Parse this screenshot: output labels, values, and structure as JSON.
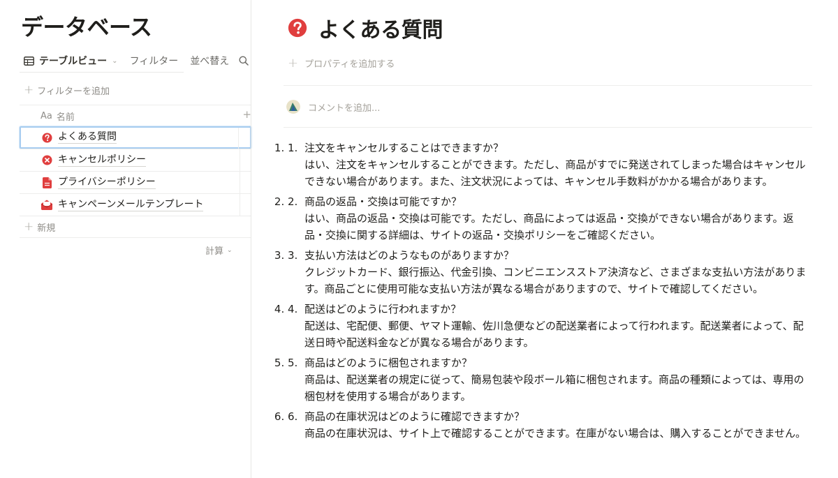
{
  "sidebar": {
    "title": "データベース",
    "view_label": "テーブルビュー",
    "filter_label": "フィルター",
    "sort_label": "並べ替え",
    "add_filter_label": "フィルターを追加",
    "column_type_label": "Aa",
    "column_name_label": "名前",
    "add_column_symbol": "+",
    "rows": [
      {
        "title": "よくある質問",
        "icon": "question-circle-icon",
        "selected": true
      },
      {
        "title": "キャンセルポリシー",
        "icon": "x-circle-icon",
        "selected": false
      },
      {
        "title": "プライバシーポリシー",
        "icon": "document-icon",
        "selected": false
      },
      {
        "title": "キャンペーンメールテンプレート",
        "icon": "mail-open-icon",
        "selected": false
      }
    ],
    "new_label": "新規",
    "calc_label": "計算"
  },
  "page": {
    "title": "よくある質問",
    "icon": "question-circle-icon",
    "add_property_label": "プロパティを追加する",
    "comment_placeholder": "コメントを追加...",
    "faq": [
      {
        "num": "1.",
        "question": "注文をキャンセルすることはできますか？",
        "answer": "はい、注文をキャンセルすることができます。ただし、商品がすでに発送されてしまった場合はキャンセルできない場合があります。また、注文状況によっては、キャンセル手数料がかかる場合があります。"
      },
      {
        "num": "2.",
        "question": "商品の返品・交換は可能ですか？",
        "answer": "はい、商品の返品・交換は可能です。ただし、商品によっては返品・交換ができない場合があります。返品・交換に関する詳細は、サイトの返品・交換ポリシーをご確認ください。"
      },
      {
        "num": "3.",
        "question": "支払い方法はどのようなものがありますか？",
        "answer": "クレジットカード、銀行振込、代金引換、コンビニエンスストア決済など、さまざまな支払い方法があります。商品ごとに使用可能な支払い方法が異なる場合がありますので、サイトで確認してください。"
      },
      {
        "num": "4.",
        "question": "配送はどのように行われますか？",
        "answer": "配送は、宅配便、郵便、ヤマト運輸、佐川急便などの配送業者によって行われます。配送業者によって、配送日時や配送料金などが異なる場合があります。"
      },
      {
        "num": "5.",
        "question": "商品はどのように梱包されますか？",
        "answer": "商品は、配送業者の規定に従って、簡易包装や段ボール箱に梱包されます。商品の種類によっては、専用の梱包材を使用する場合があります。"
      },
      {
        "num": "6.",
        "question": "商品の在庫状況はどのように確認できますか？",
        "answer": "商品の在庫状況は、サイト上で確認することができます。在庫がない場合は、購入することができません。"
      }
    ]
  },
  "colors": {
    "icon_red": "#e03e3e",
    "text": "#37352f",
    "muted": "#8f8d88",
    "selection": "#a8cdf0"
  }
}
